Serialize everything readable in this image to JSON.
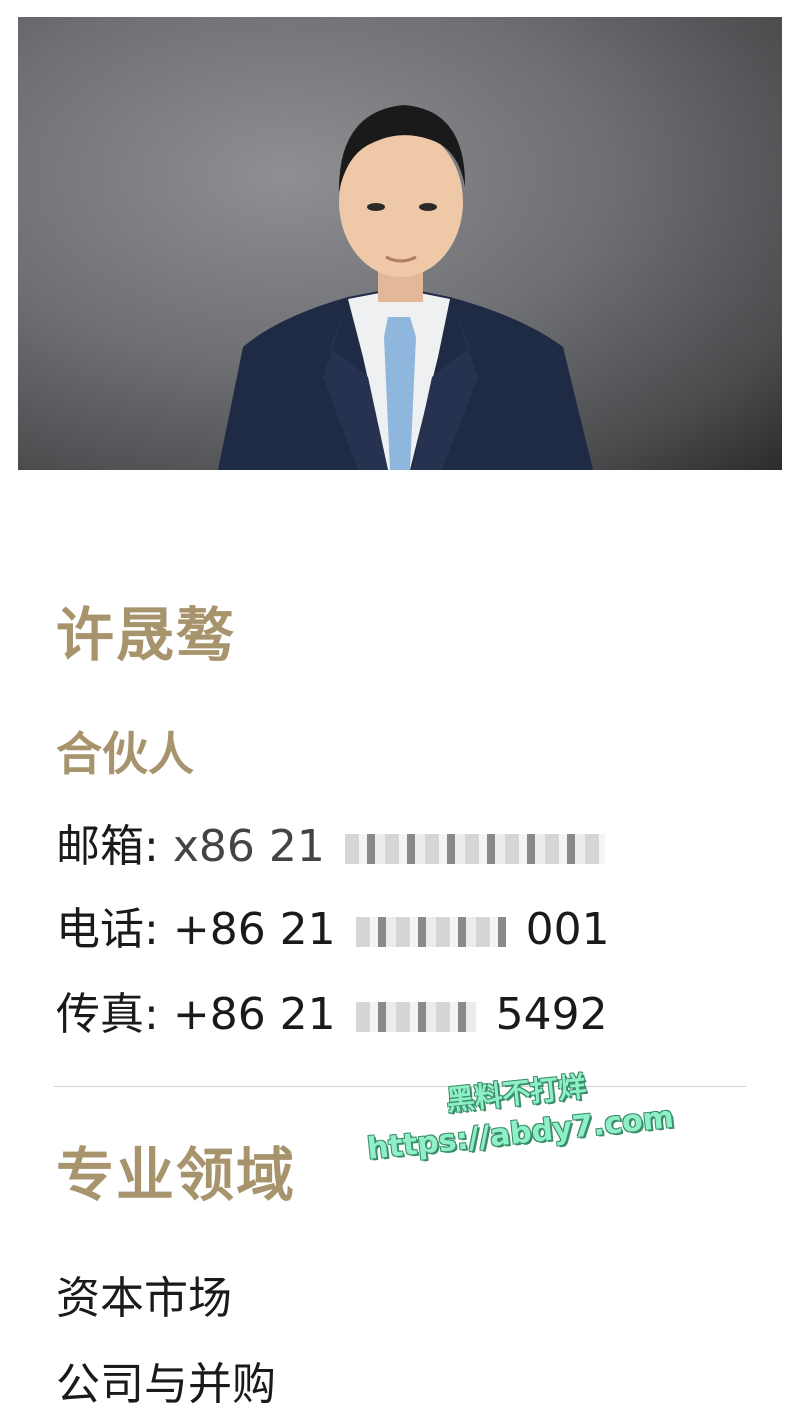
{
  "profile": {
    "photo_alt": "portrait-photo",
    "name": "许晟骜",
    "role": "合伙人",
    "email_label": "邮箱:",
    "email_value_visible": "x86 21",
    "phone_label": "电话:",
    "phone_prefix": "+86 21",
    "phone_suffix": "001",
    "fax_label": "传真:",
    "fax_prefix": "+86 21",
    "fax_suffix": "5492"
  },
  "practice": {
    "title": "专业领域",
    "items": [
      "资本市场",
      "公司与并购"
    ]
  },
  "watermark": {
    "line1": "黑料不打烊",
    "line2": "https://abdy7.com"
  },
  "colors": {
    "accent_gold": "#a8946c",
    "text": "#1a1a1a",
    "watermark": "#8ff0c8"
  }
}
